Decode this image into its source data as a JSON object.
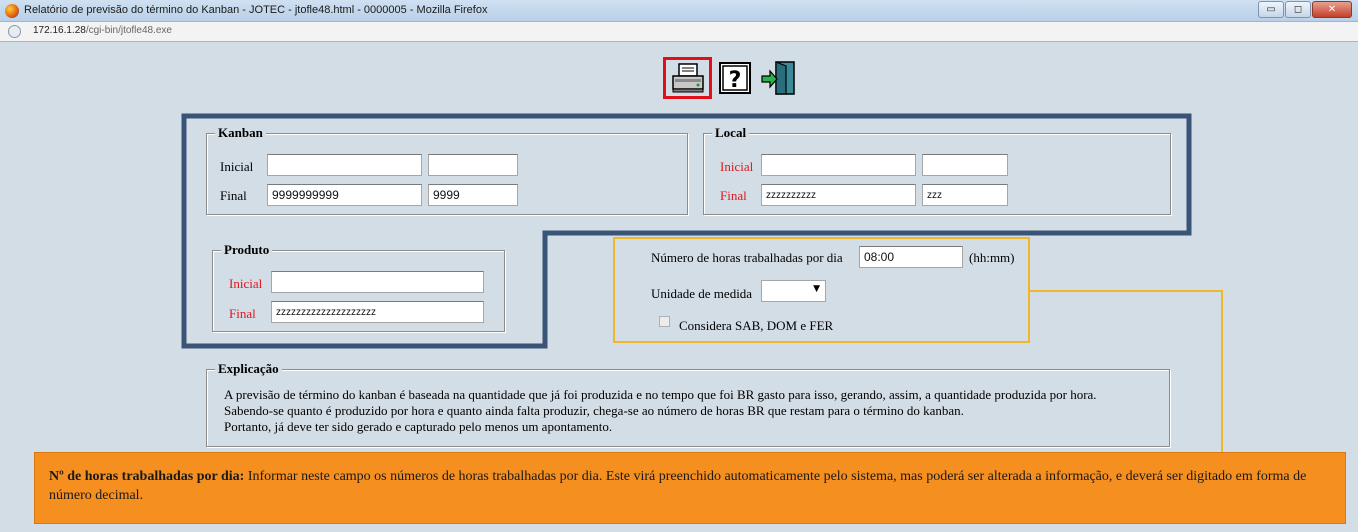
{
  "window": {
    "title": "Relatório de previsão do término do Kanban - JOTEC - jtofle48.html - 0000005 - Mozilla Firefox",
    "url_host": "172.16.1.28",
    "url_path": "/cgi-bin/jtofle48.exe",
    "min_icon": "minimize-icon",
    "max_icon": "maximize-icon",
    "close_icon": "close-icon",
    "min_glyph": "▭",
    "max_glyph": "◻",
    "close_glyph": "✕"
  },
  "toolbar": {
    "icons": [
      "printer-icon",
      "help-icon",
      "exit-door-icon"
    ],
    "highlight_color": "#e0101a"
  },
  "kanban": {
    "legend": "Kanban",
    "inicial_label": "Inicial",
    "final_label": "Final",
    "inicial_value1": "",
    "inicial_value2": "",
    "final_value1": "9999999999",
    "final_value2": "9999"
  },
  "local": {
    "legend": "Local",
    "inicial_label": "Inicial",
    "final_label": "Final",
    "inicial_value1": "",
    "inicial_value2": "",
    "final_value1": "zzzzzzzzzz",
    "final_value2": "zzz"
  },
  "produto": {
    "legend": "Produto",
    "inicial_label": "Inicial",
    "final_label": "Final",
    "inicial_value": "",
    "final_value": "zzzzzzzzzzzzzzzzzzzz"
  },
  "options": {
    "horas_label": "Número de horas trabalhadas por dia",
    "horas_value": "08:00",
    "horas_unit": "(hh:mm)",
    "unidade_label": "Unidade de medida",
    "unidade_value": "",
    "considera_label": "Considera SAB, DOM e FER",
    "considera_checked": false
  },
  "explicacao": {
    "legend": "Explicação",
    "lines": [
      "A previsão de término do kanban é baseada na quantidade que já foi produzida e no tempo que foi BR gasto para isso, gerando, assim, a quantidade produzida por hora.",
      "Sabendo-se quanto é produzido por hora e quanto ainda falta produzir, chega-se ao número de horas BR que restam para o término do kanban.",
      "Portanto, já deve ter sido gerado e capturado pelo menos um apontamento."
    ]
  },
  "callout": {
    "title": "Nº de horas trabalhadas por dia:",
    "text": " Informar neste campo os números de horas trabalhadas por dia. Este virá preenchido automaticamente pelo sistema, mas poderá ser alterada a informação, e deverá ser digitado em forma de número decimal."
  },
  "colors": {
    "background": "#d3dde6",
    "frame_blue": "#3a5478",
    "callout_yellow": "#f0b72a",
    "callout_orange": "#f58f1f",
    "required_red": "#e3141c"
  }
}
